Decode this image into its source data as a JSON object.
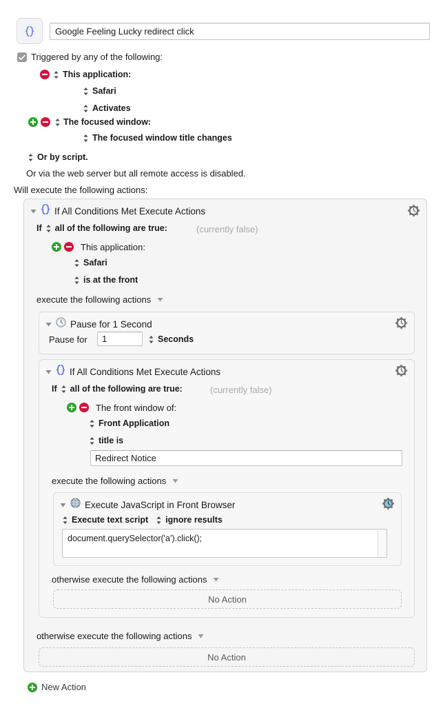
{
  "macro": {
    "icon": "braces-icon",
    "title_value": "Google Feeling Lucky redirect click",
    "title_placeholder": "Macro Name"
  },
  "triggers": {
    "checkbox_checked": true,
    "label": "Triggered by any of the following:",
    "items": [
      {
        "id": "this-application",
        "remove_icon": "minus-circle-icon",
        "add_icon": null,
        "stepper_icon": "stepper-icon",
        "label": "This application:",
        "sub": [
          {
            "stepper_icon": "stepper-icon",
            "label": "Safari"
          },
          {
            "stepper_icon": "stepper-icon",
            "label": "Activates"
          }
        ]
      },
      {
        "id": "focused-window",
        "remove_icon": "minus-circle-icon",
        "add_icon": "plus-circle-icon",
        "stepper_icon": "stepper-icon",
        "label": "The focused window:",
        "sub": [
          {
            "stepper_icon": "stepper-icon",
            "label": "The focused window title changes"
          }
        ]
      }
    ],
    "or_by_script": "Or by script.",
    "web_server_note": "Or via the web server but all remote access is disabled."
  },
  "actions_header": "Will execute the following actions:",
  "action_outer": {
    "disclosure_icon": "triangle-down-icon",
    "icon": "braces-icon",
    "title": "If All Conditions Met Execute Actions",
    "gear_icon": "gear-clock-icon",
    "condition": {
      "if_label": "If",
      "stepper_icon": "stepper-icon",
      "match_label": "all of the following are true:",
      "state": "(currently false)",
      "rows": [
        {
          "add_icon": "plus-circle-icon",
          "remove_icon": "minus-circle-icon",
          "label": "This application:"
        }
      ],
      "sub": [
        {
          "stepper_icon": "stepper-icon",
          "label": "Safari"
        },
        {
          "stepper_icon": "stepper-icon",
          "label": "is at the front"
        }
      ]
    },
    "execute_label": "execute the following actions",
    "execute_disclosure_icon": "triangle-down-icon",
    "otherwise_label": "otherwise execute the following actions",
    "otherwise_disclosure_icon": "triangle-down-icon",
    "otherwise_no_action": "No Action"
  },
  "action_pause": {
    "disclosure_icon": "triangle-down-icon",
    "icon": "clock-icon",
    "title": "Pause for 1 Second",
    "gear_icon": "gear-clock-icon",
    "field_label": "Pause for",
    "field_value": "1",
    "unit_stepper_icon": "stepper-icon",
    "unit_label": "Seconds"
  },
  "action_inner_if": {
    "disclosure_icon": "triangle-down-icon",
    "icon": "braces-icon",
    "title": "If All Conditions Met Execute Actions",
    "gear_icon": "gear-clock-icon",
    "condition": {
      "if_label": "If",
      "stepper_icon": "stepper-icon",
      "match_label": "all of the following are true:",
      "state": "(currently false)",
      "rows": [
        {
          "add_icon": "plus-circle-icon",
          "remove_icon": "minus-circle-icon",
          "label": "The front window of:"
        }
      ],
      "sub": [
        {
          "stepper_icon": "stepper-icon",
          "label": "Front Application"
        },
        {
          "stepper_icon": "stepper-icon",
          "label": "title is"
        }
      ],
      "title_field_value": "Redirect Notice"
    },
    "execute_label": "execute the following actions",
    "execute_disclosure_icon": "triangle-down-icon",
    "otherwise_label": "otherwise execute the following actions",
    "otherwise_disclosure_icon": "triangle-down-icon",
    "otherwise_no_action": "No Action"
  },
  "action_javascript": {
    "disclosure_icon": "triangle-down-icon",
    "icon": "globe-icon",
    "title": "Execute JavaScript in Front Browser",
    "gear_icon": "gear-clock-blue-icon",
    "source_stepper_icon": "stepper-icon",
    "source_label": "Execute text script",
    "results_stepper_icon": "stepper-icon",
    "results_label": "ignore results",
    "script_value": "document.querySelector('a').click();"
  },
  "footer": {
    "add_icon": "plus-circle-icon",
    "new_action_label": "New Action"
  },
  "colors": {
    "accent_blue": "#6173e8",
    "add_green": "#2aa82a",
    "remove_red": "#d4143c",
    "panel_bg": "#f5f5f5",
    "panel_border": "#d5d5d7",
    "text": "#1a1a1a",
    "muted_text": "#aaaaaa",
    "gear_blue": "#7ec6e8"
  }
}
